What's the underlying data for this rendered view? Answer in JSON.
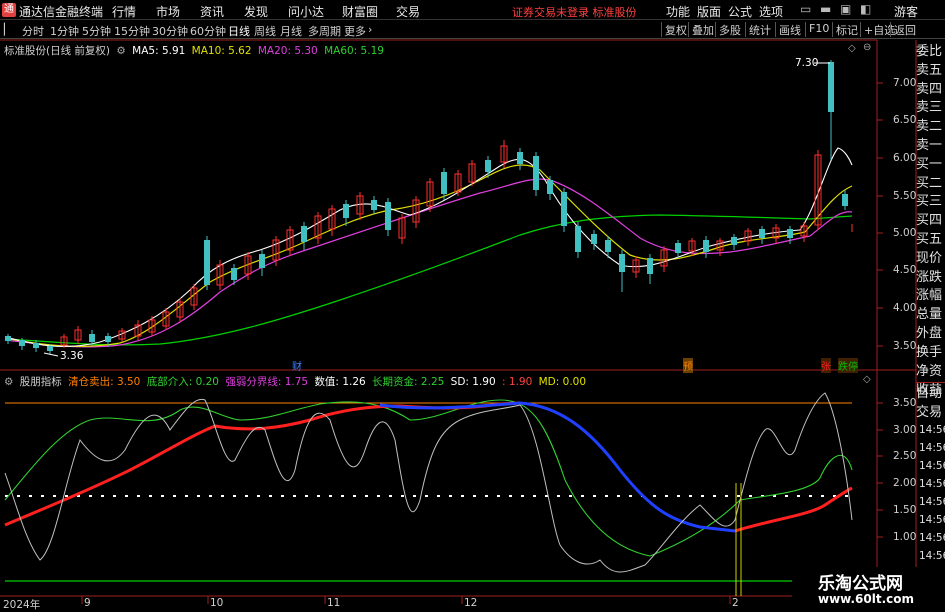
{
  "app": {
    "name": "通达信金融终端"
  },
  "menu": [
    "行情",
    "市场",
    "资讯",
    "发现",
    "问小达",
    "财富圈",
    "交易"
  ],
  "login_notice": "证券交易未登录  标准股份",
  "right_menu": [
    "功能",
    "版面",
    "公式",
    "选项"
  ],
  "window_buttons": {
    "guest": "游客"
  },
  "toolbar": {
    "periods": [
      "分时",
      "1分钟",
      "5分钟",
      "15分钟",
      "30分钟",
      "60分钟",
      "日线",
      "周线",
      "月线",
      "多周期",
      "更多"
    ],
    "active_period": "日线",
    "right_buttons": [
      "复权",
      "叠加",
      "多股",
      "统计",
      "画线",
      "F10",
      "标记",
      "+自选",
      "返回"
    ]
  },
  "main_chart": {
    "stock_title": "标准股份(日线 前复权)",
    "ma": [
      {
        "label": "MA5: 5.91",
        "color": "#ffffff"
      },
      {
        "label": "MA10: 5.62",
        "color": "#ffff00"
      },
      {
        "label": "MA20: 5.30",
        "color": "#ff40ff"
      },
      {
        "label": "MA60: 5.19",
        "color": "#00ff00"
      }
    ],
    "y_ticks": [
      "7.00",
      "6.50",
      "6.00",
      "5.50",
      "5.00",
      "4.50",
      "4.00",
      "3.50"
    ],
    "high_marker": "7.30",
    "low_marker": "3.36",
    "event_markers": [
      {
        "text": "财",
        "color": "#4080ff"
      },
      {
        "text": "预",
        "color": "#ff8000"
      },
      {
        "text": "张",
        "color": "#ff2020"
      },
      {
        "text": "跌停",
        "color": "#00c000"
      }
    ]
  },
  "indicator": {
    "name": "股朋指标",
    "params": [
      {
        "label": "清仓卖出: 3.50",
        "color": "#ff8000"
      },
      {
        "label": "底部介入: 0.20",
        "color": "#00ff00"
      },
      {
        "label": "强弱分界线: 1.75",
        "color": "#ff40ff"
      },
      {
        "label": "数值: 1.26",
        "color": "#ffffff"
      },
      {
        "label": "长期资金: 2.25",
        "color": "#00ff00"
      },
      {
        "label": "SD: 1.90",
        "color": "#ffffff"
      },
      {
        "label": ": 1.90",
        "color": "#ff4040"
      },
      {
        "label": "MD: 0.00",
        "color": "#ffff00"
      }
    ],
    "y_ticks": [
      "3.50",
      "3.00",
      "2.50",
      "2.00",
      "1.50",
      "1.00"
    ]
  },
  "x_axis": [
    "2024年",
    "9",
    "10",
    "11",
    "12",
    "2"
  ],
  "right_panel": {
    "labels": [
      "委比",
      "卖五",
      "卖四",
      "卖三",
      "卖二",
      "卖一",
      "买一",
      "买二",
      "买三",
      "买四",
      "买五",
      "现价",
      "涨跌",
      "涨幅",
      "总量",
      "外盘",
      "换手",
      "净资",
      "收益"
    ],
    "lower_labels": [
      "自动",
      "交易"
    ],
    "times": [
      "14:56",
      "14:56",
      "14:56",
      "14:56",
      "14:56",
      "14:56",
      "14:56",
      "14:56"
    ]
  },
  "watermark": {
    "title": "乐淘公式网",
    "url": "www.60lt.com"
  }
}
